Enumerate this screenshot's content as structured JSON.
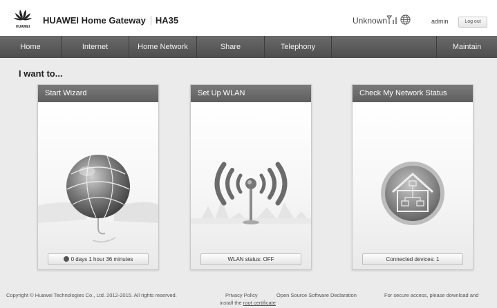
{
  "header": {
    "logo_text": "HUAWEI",
    "brand": "HUAWEI Home Gateway",
    "model": "HA35",
    "network_status": "Unknown",
    "user": "admin",
    "logout_label": "Log out"
  },
  "nav": {
    "items": [
      "Home",
      "Internet",
      "Home Network",
      "Share",
      "Telephony",
      "",
      "Maintain"
    ]
  },
  "main": {
    "section_title": "I want to...",
    "cards": [
      {
        "title": "Start Wizard",
        "status": "0 days 1 hour 36 minutes",
        "icon": "globe-wizard-icon"
      },
      {
        "title": "Set Up WLAN",
        "status": "WLAN status: OFF",
        "icon": "wlan-antenna-icon"
      },
      {
        "title": "Check My Network Status",
        "status": "Connected devices: 1",
        "icon": "home-network-icon"
      }
    ]
  },
  "footer": {
    "copyright": "Copyright © Huawei Technologies Co., Ltd. 2012-2015. All rights reserved.",
    "privacy": "Privacy Policy",
    "open_source": "Open Source Software Declaration",
    "secure_access": "For secure access, please download and",
    "install_prefix": "install the",
    "root_cert": "root certificate"
  },
  "colors": {
    "nav_bg": "#5a5a5a",
    "card_head_bg": "#6b6b6b",
    "page_bg": "#ebebeb"
  }
}
